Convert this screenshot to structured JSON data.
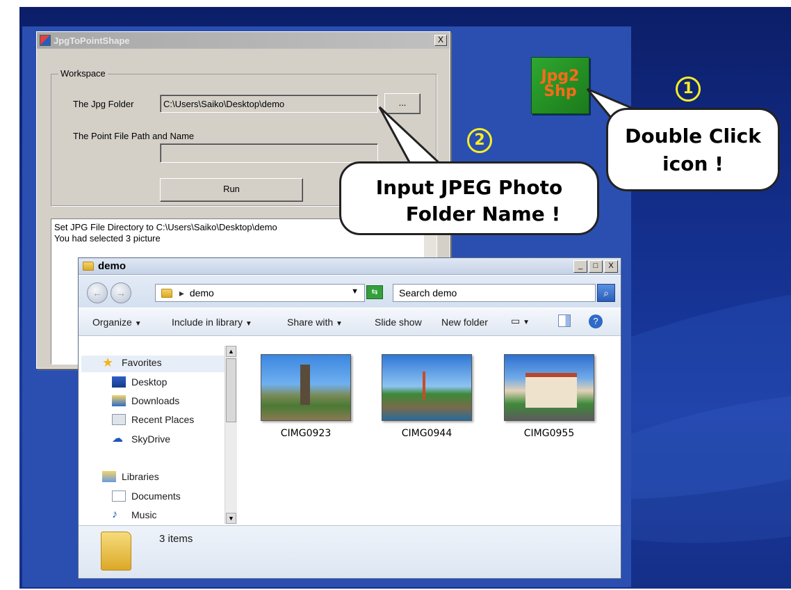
{
  "app_dialog": {
    "title": "JpgToPointShape",
    "close_glyph": "X",
    "group_label": "Workspace",
    "jpg_folder_label": "The Jpg Folder",
    "jpg_folder_value": "C:\\Users\\Saiko\\Desktop\\demo",
    "browse_label": "...",
    "point_file_label": "The Point File Path and Name",
    "point_file_value": "",
    "run_label": "Run",
    "log_lines": [
      "Set JPG File Directory to C:\\Users\\Saiko\\Desktop\\demo",
      "You had selected 3 picture"
    ]
  },
  "desktop_icon": {
    "line1": "Jpg2",
    "line2": "Shp"
  },
  "callouts": {
    "step1_number": "1",
    "step1_text_line1": "Double Click",
    "step1_text_line2": "icon !",
    "step2_number": "2",
    "step2_text_line1": "Input JPEG Photo",
    "step2_text_line2": "Folder Name !"
  },
  "explorer": {
    "title": "demo",
    "window_buttons": [
      "_",
      "□",
      "X"
    ],
    "address": "demo",
    "search_placeholder": "Search demo",
    "commands": [
      "Organize",
      "Include in library",
      "Share with",
      "Slide show",
      "New folder"
    ],
    "nav": {
      "favorites": "Favorites",
      "desktop": "Desktop",
      "downloads": "Downloads",
      "recent": "Recent Places",
      "skydrive": "SkyDrive",
      "libraries": "Libraries",
      "documents": "Documents",
      "music": "Music"
    },
    "files": [
      "CIMG0923",
      "CIMG0944",
      "CIMG0955"
    ],
    "status": "3 items"
  },
  "colors": {
    "slide_background": "#14308e",
    "callout_number": "#f7ee25",
    "icon_bg": "#2fa72f",
    "icon_text": "#ff6a1a"
  }
}
